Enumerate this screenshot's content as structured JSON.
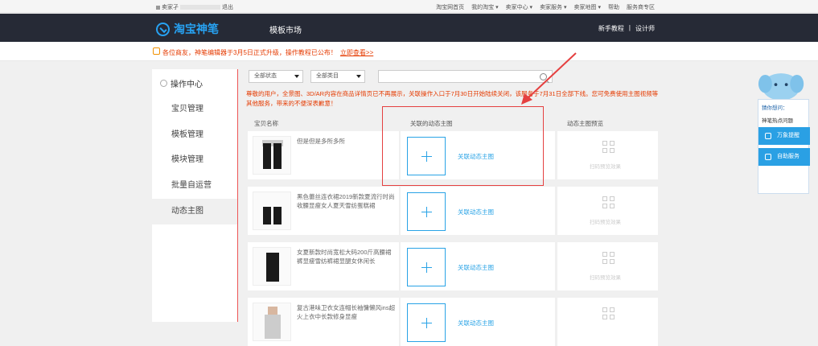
{
  "topbar": {
    "user_prefix": "卖家孑",
    "logout": "退出",
    "links": [
      "淘宝网首页",
      "我的淘宝 ▾",
      "卖家中心 ▾",
      "卖家服务 ▾",
      "卖家地图 ▾",
      "帮助",
      "服务商专区"
    ]
  },
  "header": {
    "logo_text": "淘宝神笔",
    "nav_title": "模板市场",
    "right_links": [
      "新手教程",
      "|",
      "设计师"
    ]
  },
  "notice": {
    "text": "各位商友，神笔编辑器于3月5日正式升级，操作教程已公布！",
    "link": "立即查看>>"
  },
  "sidebar": {
    "head": "操作中心",
    "items": [
      "宝贝管理",
      "模板管理",
      "模块管理",
      "批量自运营",
      "动态主图"
    ]
  },
  "filters": {
    "status": "全部状态",
    "category": "全部类目"
  },
  "warning": "尊敬的用户，全景图、3D/AR内容在商品详情页已不再展示，关联操作入口于7月30日开始陆续关闭，该服务于7月31日全部下线。您可免费使用主图视频等其他服务，带来的不便深表歉意！",
  "columns": {
    "name": "宝贝名称",
    "linked": "关联的动态主图",
    "preview": "动态主图预览"
  },
  "rows": [
    {
      "name": "但是但是多所多所"
    },
    {
      "name": "黑色蕾丝连衣裙2019新款夏流行时尚收腰显瘦女人夏天雪纺蛋糕裙"
    },
    {
      "name": "女夏新款时尚宽松大码200斤高腰裙裤显瘦雪纺裤裙显腿女休闲长"
    },
    {
      "name": "复古港味卫衣女连帽长袖慵懒风ins超火上衣中长款修身显瘦"
    }
  ],
  "row_labels": {
    "add_link": "关联动态主图",
    "preview_empty": "扫码预览效果"
  },
  "float": {
    "title": "猜你想问：",
    "question": "神笔热点问题",
    "btn1": "万象提醒",
    "btn2": "自助服务"
  },
  "colors": {
    "header_bg": "#262a36",
    "brand": "#27a2f2",
    "alert": "#e53a00",
    "highlight": "#e54040"
  }
}
